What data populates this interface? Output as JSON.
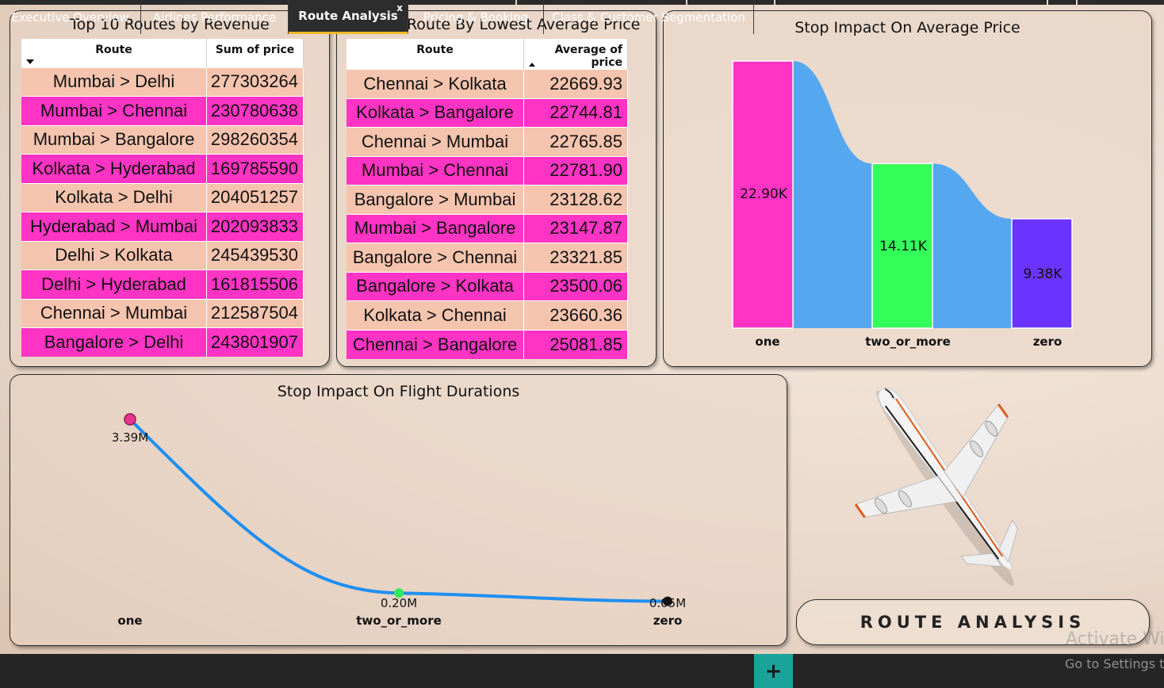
{
  "revenue_table": {
    "title": "Top 10 Routes by Revenue",
    "columns": [
      "Route",
      "Sum of price"
    ],
    "rows": [
      {
        "route": "Mumbai > Delhi",
        "value": "277303264"
      },
      {
        "route": "Mumbai > Chennai",
        "value": "230780638"
      },
      {
        "route": "Mumbai > Bangalore",
        "value": "298260354"
      },
      {
        "route": "Kolkata > Hyderabad",
        "value": "169785590"
      },
      {
        "route": "Kolkata > Delhi",
        "value": "204051257"
      },
      {
        "route": "Hyderabad > Mumbai",
        "value": "202093833"
      },
      {
        "route": "Delhi > Kolkata",
        "value": "245439530"
      },
      {
        "route": "Delhi > Hyderabad",
        "value": "161815506"
      },
      {
        "route": "Chennai > Mumbai",
        "value": "212587504"
      },
      {
        "route": "Bangalore > Delhi",
        "value": "243801907"
      }
    ]
  },
  "price_table": {
    "title": "Top 10 Route By Lowest Average Price",
    "columns": [
      "Route",
      "Average of price"
    ],
    "rows": [
      {
        "route": "Chennai > Kolkata",
        "value": "22669.93"
      },
      {
        "route": "Kolkata > Bangalore",
        "value": "22744.81"
      },
      {
        "route": "Chennai > Mumbai",
        "value": "22765.85"
      },
      {
        "route": "Mumbai > Chennai",
        "value": "22781.90"
      },
      {
        "route": "Bangalore > Mumbai",
        "value": "23128.62"
      },
      {
        "route": "Mumbai > Bangalore",
        "value": "23147.87"
      },
      {
        "route": "Bangalore > Chennai",
        "value": "23321.85"
      },
      {
        "route": "Bangalore > Kolkata",
        "value": "23500.06"
      },
      {
        "route": "Kolkata > Chennai",
        "value": "23660.36"
      },
      {
        "route": "Chennai > Bangalore",
        "value": "25081.85"
      }
    ]
  },
  "chart_data": [
    {
      "type": "bar",
      "title": "Stop Impact On Average Price",
      "categories": [
        "one",
        "two_or_more",
        "zero"
      ],
      "values": [
        22900,
        14110,
        9380
      ],
      "labels": [
        "22.90K",
        "14.11K",
        "9.38K"
      ],
      "colors": [
        "#ff33c4",
        "#33ff5a",
        "#6b33ff"
      ],
      "ribbon_color": "#55a8f0",
      "ylim": [
        0,
        22900
      ],
      "grid": false
    },
    {
      "type": "line",
      "title": "Stop Impact On Flight Durations",
      "categories": [
        "one",
        "two_or_more",
        "zero"
      ],
      "values": [
        3390000,
        200000,
        50000
      ],
      "labels": [
        "3.39M",
        "0.20M",
        "0.05M"
      ],
      "line_color": "#1e8ff0",
      "marker_colors": [
        "#e8338f",
        "#33e85a",
        "#111111"
      ],
      "ylim": [
        0,
        3390000
      ],
      "grid": false
    }
  ],
  "banner": {
    "text": "ROUTE ANALYSIS"
  },
  "tabs": [
    {
      "label": "Executive Overview"
    },
    {
      "label": "Airlines Performance"
    },
    {
      "label": "Route Analysis",
      "close": "x"
    },
    {
      "label": "Pricing & Booking"
    },
    {
      "label": "Class & Customer Segmentation"
    }
  ],
  "add_tab": {
    "label": "+"
  },
  "watermark": {
    "line1": "Activate Wi",
    "line2": "Go to Settings t"
  }
}
